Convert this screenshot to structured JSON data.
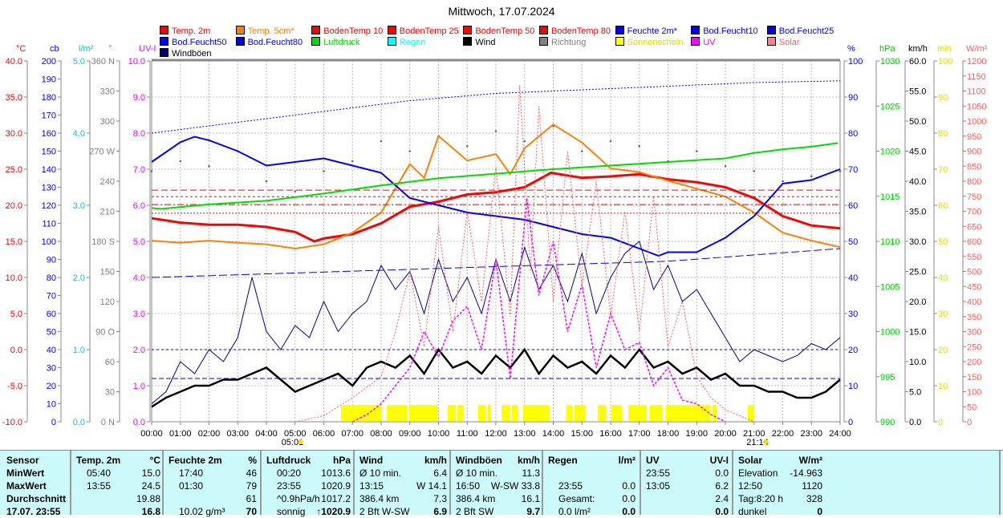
{
  "title": "Mittwoch, 17.07.2024",
  "legend": [
    {
      "label": "Temp. 2m",
      "color": "#ff0000"
    },
    {
      "label": "Temp. 5cm*",
      "color": "#ff8000"
    },
    {
      "label": "BodenTemp 10",
      "color": "#ff0000"
    },
    {
      "label": "BodenTemp 25",
      "color": "#ff0000"
    },
    {
      "label": "BodenTemp 50",
      "color": "#ff0000"
    },
    {
      "label": "BodenTemp 80",
      "color": "#ff0000"
    },
    {
      "label": "Feuchte 2m*",
      "color": "#0000ff"
    },
    {
      "label": "Bod.Feucht10",
      "color": "#0000ff"
    },
    {
      "label": "Bod.Feucht25",
      "color": "#0000ff"
    },
    {
      "label": "Bod.Feucht50",
      "color": "#0000ff"
    },
    {
      "label": "Bod.Feucht80",
      "color": "#0000ff"
    },
    {
      "label": "Luftdruck",
      "color": "#00dd00"
    },
    {
      "label": "Regen",
      "color": "#00ffff"
    },
    {
      "label": "Wind",
      "color": "#000000"
    },
    {
      "label": "Richtung",
      "color": "#808080"
    },
    {
      "label": "Sonnenschein",
      "color": "#ffff00"
    },
    {
      "label": "UV",
      "color": "#ff00ff"
    },
    {
      "label": "Solar",
      "color": "#ff8080"
    },
    {
      "label": "Windböen",
      "color": "#000080"
    }
  ],
  "chart_data": {
    "type": "line",
    "title": "Mittwoch, 17.07.2024",
    "x_ticks": [
      "00:00",
      "01:00",
      "02:00",
      "03:00",
      "04:00",
      "05:00",
      "06:00",
      "07:00",
      "08:00",
      "09:00",
      "10:00",
      "11:00",
      "12:00",
      "13:00",
      "14:00",
      "15:00",
      "16:00",
      "17:00",
      "18:00",
      "19:00",
      "20:00",
      "21:00",
      "22:00",
      "23:00",
      "24:00"
    ],
    "sunrise": "05:01",
    "sunset": "21:14",
    "sunrise_h": 5.02,
    "sunset_h": 21.23,
    "axes": {
      "temp": {
        "unit": "°C",
        "min": -10,
        "max": 40,
        "step": 5,
        "dec": 1,
        "color": "#ff0000",
        "side": "left"
      },
      "cb": {
        "unit": "cb",
        "min": 0,
        "max": 200,
        "step": 10,
        "dec": 0,
        "color": "#0000ff",
        "side": "left"
      },
      "rain": {
        "unit": "l/m²",
        "min": 0,
        "max": 5,
        "step": 1,
        "dec": 1,
        "color": "#00cccc",
        "side": "left"
      },
      "dir": {
        "unit": "°",
        "min": 0,
        "max": 360,
        "step": 30,
        "dec": 0,
        "color": "#808080",
        "side": "left",
        "names": {
          "0": "N",
          "90": "O",
          "180": "S",
          "270": "W",
          "360": "N"
        }
      },
      "uv": {
        "unit": "UV-I",
        "min": 0,
        "max": 10,
        "step": 1,
        "dec": 1,
        "color": "#ff00ff",
        "side": "left"
      },
      "hum": {
        "unit": "%",
        "min": 0,
        "max": 100,
        "step": 10,
        "dec": 0,
        "color": "#0000ff",
        "side": "right"
      },
      "press": {
        "unit": "hPa",
        "min": 990,
        "max": 1030,
        "step": 5,
        "dec": 0,
        "color": "#00cc00",
        "side": "right"
      },
      "wind": {
        "unit": "km/h",
        "min": 0,
        "max": 60,
        "step": 5,
        "dec": 1,
        "color": "#000000",
        "side": "right"
      },
      "sun": {
        "unit": "min",
        "min": 0,
        "max": 100,
        "step": 10,
        "dec": 0,
        "color": "#e0e000",
        "side": "right"
      },
      "solar": {
        "unit": "W/m²",
        "min": 0,
        "max": 1200,
        "step": 50,
        "dec": 0,
        "color": "#ff6060",
        "side": "right"
      }
    },
    "series": [
      {
        "name": "Temp. 2m",
        "axis": "temp",
        "color": "#ff0000",
        "width": 3,
        "dash": "",
        "x": [
          0,
          1,
          2,
          3,
          4,
          5,
          5.67,
          6,
          7,
          8,
          9,
          10,
          11,
          12,
          13,
          13.92,
          15,
          16,
          17,
          18,
          19,
          20,
          21,
          22,
          23,
          24
        ],
        "y": [
          18.2,
          17.6,
          17.3,
          17.3,
          17.0,
          16.3,
          15.0,
          15.4,
          16.0,
          17.5,
          19.8,
          20.5,
          21.5,
          21.8,
          22.5,
          24.5,
          23.8,
          24.0,
          24.3,
          23.6,
          23.2,
          22.5,
          21.0,
          18.5,
          17.2,
          16.8
        ]
      },
      {
        "name": "Temp. 5cm*",
        "axis": "temp",
        "color": "#ff8000",
        "width": 2,
        "dash": "",
        "x": [
          0,
          1,
          2,
          3,
          4,
          5,
          6,
          7,
          8,
          9,
          9.5,
          10,
          11,
          12,
          12.5,
          13,
          14,
          15,
          16,
          17,
          18,
          19,
          20,
          21,
          22,
          23,
          24
        ],
        "y": [
          15.1,
          14.8,
          15.1,
          14.8,
          14.6,
          14.0,
          14.6,
          16.2,
          19.0,
          25.7,
          23.8,
          29.6,
          26.2,
          27.1,
          24.3,
          27.9,
          31.2,
          28.7,
          25.1,
          24.6,
          23.4,
          22.3,
          21.2,
          19.0,
          16.2,
          15.1,
          14.2
        ]
      },
      {
        "name": "BodenTemp 10",
        "axis": "temp",
        "color": "#ff0000",
        "width": 1,
        "dash": "8,4",
        "x": [
          0,
          24
        ],
        "y": [
          22.1,
          22.1
        ]
      },
      {
        "name": "BodenTemp 25",
        "axis": "temp",
        "color": "#ff0000",
        "width": 1,
        "dash": "3,3",
        "x": [
          0,
          24
        ],
        "y": [
          21.2,
          21.2
        ]
      },
      {
        "name": "BodenTemp 50",
        "axis": "temp",
        "color": "#ff0000",
        "width": 1,
        "dash": "8,3,2,3",
        "x": [
          0,
          24
        ],
        "y": [
          20.1,
          20.1
        ]
      },
      {
        "name": "BodenTemp 80",
        "axis": "temp",
        "color": "#ff0000",
        "width": 1,
        "dash": "2,2",
        "x": [
          0,
          24
        ],
        "y": [
          18.9,
          18.9
        ]
      },
      {
        "name": "Feuchte 2m*",
        "axis": "hum",
        "color": "#0000ff",
        "width": 2,
        "dash": "",
        "x": [
          0,
          1,
          1.5,
          2,
          3,
          4,
          5,
          6,
          7,
          8,
          9,
          10,
          11,
          12,
          13,
          14,
          15,
          16,
          17,
          17.67,
          18,
          19,
          20,
          21,
          22,
          23,
          24
        ],
        "y": [
          72,
          77.5,
          79,
          78,
          75,
          71,
          72,
          73,
          71,
          69,
          62,
          60,
          58,
          57,
          56,
          54,
          52,
          51,
          48,
          46,
          47,
          47,
          51,
          57,
          66,
          67,
          70
        ]
      },
      {
        "name": "Bod.Feucht10",
        "axis": "hum",
        "color": "#0000ff",
        "width": 1,
        "dash": "2,2",
        "x": [
          0,
          3,
          6,
          9,
          12,
          15,
          18,
          21,
          24
        ],
        "y": [
          80,
          83,
          86,
          89,
          91,
          92,
          93,
          94,
          94.5
        ]
      },
      {
        "name": "Bod.Feucht25",
        "axis": "hum",
        "color": "#0000ff",
        "width": 1,
        "dash": "10,4",
        "x": [
          0,
          6,
          12,
          18,
          24
        ],
        "y": [
          40,
          41.5,
          43,
          44.5,
          48
        ]
      },
      {
        "name": "Bod.Feucht50",
        "axis": "hum",
        "color": "#0000ff",
        "width": 1,
        "dash": "3,3",
        "x": [
          0,
          24
        ],
        "y": [
          20,
          20
        ]
      },
      {
        "name": "Bod.Feucht80",
        "axis": "hum",
        "color": "#0000ff",
        "width": 1,
        "dash": "6,3",
        "x": [
          0,
          24
        ],
        "y": [
          12,
          12
        ]
      },
      {
        "name": "Luftdruck",
        "axis": "press",
        "color": "#00dd00",
        "width": 2,
        "dash": "",
        "x": [
          0,
          0.33,
          2,
          4,
          6,
          8,
          10,
          12,
          14,
          16,
          18,
          20,
          21,
          22,
          23,
          23.92
        ],
        "y": [
          1013.7,
          1013.6,
          1014.1,
          1014.5,
          1015.3,
          1016.2,
          1017.0,
          1017.5,
          1018.0,
          1018.4,
          1018.8,
          1019.2,
          1019.8,
          1020.2,
          1020.5,
          1020.9
        ]
      },
      {
        "name": "Windböen",
        "axis": "wind",
        "color": "#000080",
        "width": 1,
        "dash": "",
        "step": 0.5,
        "y": [
          3,
          5,
          10,
          8,
          12,
          10,
          14,
          24,
          15,
          12,
          16,
          14,
          20,
          15,
          18,
          20,
          26,
          22,
          25,
          18,
          27,
          20,
          24,
          18,
          27,
          20,
          29,
          22,
          26,
          20,
          28,
          18,
          24,
          28,
          30,
          22,
          26,
          20,
          22,
          18,
          14,
          10,
          12,
          11,
          10,
          11,
          13,
          12,
          14
        ]
      },
      {
        "name": "Wind",
        "axis": "wind",
        "color": "#000000",
        "width": 2.5,
        "dash": "",
        "step": 0.5,
        "y": [
          2.5,
          4,
          5,
          6,
          6,
          7,
          7,
          8,
          9,
          7,
          5,
          6,
          7,
          8,
          6,
          9,
          10,
          9,
          11,
          8,
          12,
          9,
          10,
          8,
          11,
          9,
          12,
          8,
          11,
          9,
          10,
          8,
          11,
          9,
          12,
          9,
          10,
          8,
          9,
          7,
          8,
          6,
          6,
          5,
          5,
          4,
          4,
          5,
          7
        ]
      },
      {
        "name": "UV",
        "axis": "uv",
        "color": "#ff00ff",
        "width": 1.5,
        "dash": "3,2",
        "x": [
          7,
          7.5,
          8,
          8.5,
          9,
          9.5,
          10,
          10.5,
          11,
          11.5,
          12,
          12.5,
          13.08,
          13.5,
          14,
          14.5,
          15,
          15.5,
          16,
          16.5,
          17,
          17.5,
          18,
          18.5,
          19,
          19.5,
          20
        ],
        "y": [
          0,
          0.2,
          0.5,
          1,
          1.5,
          2.5,
          1.8,
          2.8,
          3.2,
          2.0,
          4.5,
          1.2,
          6.2,
          3.5,
          5.0,
          2.5,
          3.8,
          1.5,
          3.0,
          2.0,
          2.2,
          1.0,
          1.5,
          0.6,
          0.5,
          0.2,
          0
        ]
      },
      {
        "name": "Solar",
        "axis": "solar",
        "color": "#ff6060",
        "width": 1,
        "dash": "2,2",
        "x": [
          5,
          6,
          7,
          8,
          8.5,
          9,
          9.5,
          10,
          10.5,
          11,
          11.5,
          12,
          12.5,
          12.83,
          13.2,
          13.5,
          14,
          14.5,
          15,
          15.5,
          16,
          16.5,
          17,
          17.5,
          18,
          18.5,
          19,
          19.5,
          20,
          21
        ],
        "y": [
          0,
          20,
          80,
          150,
          300,
          500,
          250,
          650,
          300,
          700,
          400,
          850,
          350,
          1120,
          500,
          1050,
          400,
          900,
          450,
          800,
          350,
          700,
          300,
          750,
          250,
          400,
          150,
          80,
          40,
          0
        ]
      }
    ],
    "direction": {
      "axis": "dir",
      "step": 1,
      "y": [
        250,
        260,
        255,
        270,
        240,
        230,
        250,
        260,
        280,
        270,
        285,
        275,
        290,
        280,
        295,
        270,
        280,
        275,
        260,
        270,
        255,
        250,
        240,
        245,
        250
      ]
    },
    "sunshine": {
      "axis": "sun",
      "level": 4.7,
      "intervals": [
        [
          6.6,
          8.0
        ],
        [
          8.2,
          8.9
        ],
        [
          8.98,
          9.96
        ],
        [
          10.32,
          10.6
        ],
        [
          10.66,
          10.88
        ],
        [
          11.38,
          11.64
        ],
        [
          11.72,
          11.83
        ],
        [
          12.2,
          12.5
        ],
        [
          12.56,
          12.76
        ],
        [
          12.95,
          13.87
        ],
        [
          14.46,
          14.66
        ],
        [
          14.74,
          15.13
        ],
        [
          15.55,
          15.83
        ],
        [
          16.03,
          16.39
        ],
        [
          16.62,
          17.26
        ],
        [
          17.37,
          17.79
        ],
        [
          17.93,
          19.47
        ],
        [
          19.55,
          19.69
        ],
        [
          20.78,
          21.01
        ]
      ]
    }
  },
  "table": {
    "sensor": [
      "Sensor",
      "MinWert",
      "MaxWert",
      "Durchschnitt",
      "17.07. 23:55"
    ],
    "groups": [
      {
        "head": [
          "Temp. 2m",
          "°C"
        ],
        "rows": [
          [
            "05:40",
            "15.0"
          ],
          [
            "13:55",
            "24.5"
          ],
          [
            "",
            "19.88"
          ],
          [
            "",
            "16.8"
          ]
        ]
      },
      {
        "head": [
          "Feuchte 2m",
          "%"
        ],
        "rows": [
          [
            "17:40",
            "46"
          ],
          [
            "01:30",
            "79"
          ],
          [
            "",
            "61"
          ],
          [
            "10.02 g/m³",
            "70"
          ]
        ]
      },
      {
        "head": [
          "Luftdruck",
          "hPa"
        ],
        "rows": [
          [
            "00:20",
            "1013.6"
          ],
          [
            "23:55",
            "1020.9"
          ],
          [
            "^0.9hPa/h",
            "1017.2"
          ],
          [
            "sonnig",
            "↑1020.9"
          ]
        ]
      },
      {
        "head": [
          "Wind",
          "km/h"
        ],
        "rows": [
          [
            "Ø 10 min.",
            "6.4"
          ],
          [
            "13:15",
            "W 14.1"
          ],
          [
            "386.4 km",
            "7.3"
          ],
          [
            "2 Bft W-SW",
            "6.9"
          ]
        ]
      },
      {
        "head": [
          "Windböen",
          "km/h"
        ],
        "rows": [
          [
            "Ø 10 min.",
            "11.3"
          ],
          [
            "16:50",
            "W-SW 33.8"
          ],
          [
            "386.4 km",
            "16.1"
          ],
          [
            "2 Bft SW",
            "9.7"
          ]
        ]
      },
      {
        "head": [
          "Regen",
          "l/m²"
        ],
        "rows": [
          [
            "",
            ""
          ],
          [
            "23:55",
            "0.0"
          ],
          [
            "Gesamt:",
            "0.0"
          ],
          [
            "0.0 l/m²",
            "0.0"
          ]
        ]
      },
      {
        "head": [
          "UV",
          "UV-I"
        ],
        "rows": [
          [
            "23:55",
            "0.0"
          ],
          [
            "13:05",
            "6.2"
          ],
          [
            "",
            "2.4"
          ],
          [
            "",
            "0.0"
          ]
        ]
      },
      {
        "head": [
          "Solar",
          "W/m²"
        ],
        "rows": [
          [
            "Elevation",
            "-14.963"
          ],
          [
            "12:50",
            "1120"
          ],
          [
            "Tag:8:20 h",
            "328"
          ],
          [
            "dunkel",
            "0"
          ]
        ]
      }
    ]
  }
}
